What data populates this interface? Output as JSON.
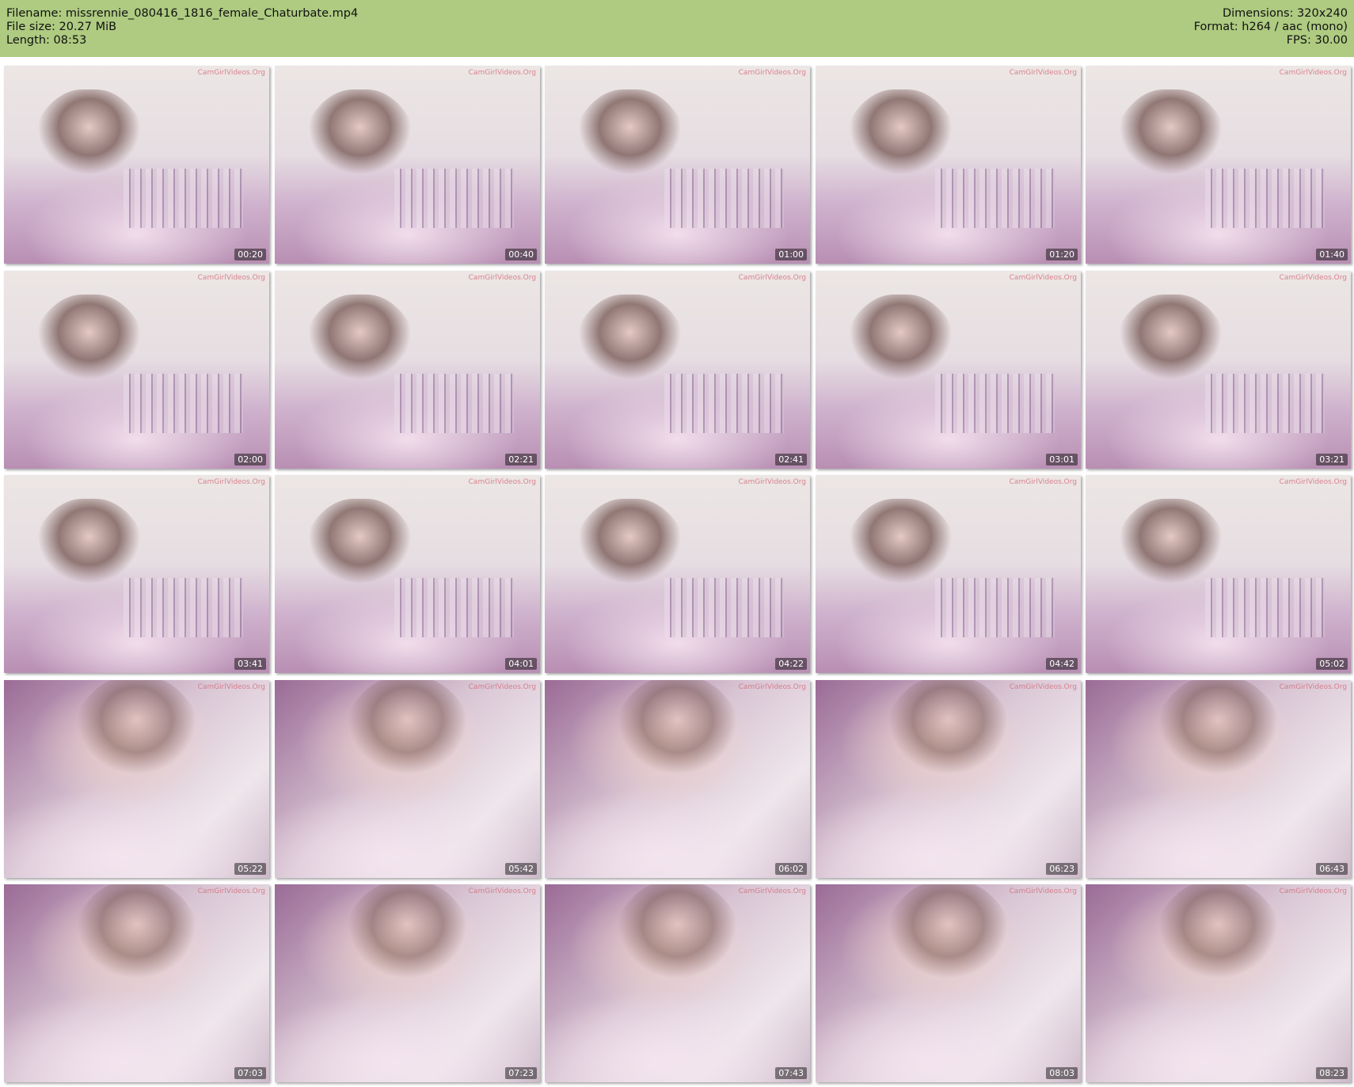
{
  "header": {
    "filename": "Filename: missrennie_080416_1816_female_Chaturbate.mp4",
    "filesize": "File size: 20.27 MiB",
    "length": "Length: 08:53",
    "dimensions": "Dimensions: 320x240",
    "format": "Format: h264 / aac (mono)",
    "fps": "FPS: 30.00"
  },
  "watermark": "CamGirlVideos.Org",
  "thumbnails": [
    {
      "time": "00:20",
      "shot": "wide"
    },
    {
      "time": "00:40",
      "shot": "wide"
    },
    {
      "time": "01:00",
      "shot": "wide"
    },
    {
      "time": "01:20",
      "shot": "wide"
    },
    {
      "time": "01:40",
      "shot": "wide"
    },
    {
      "time": "02:00",
      "shot": "wide"
    },
    {
      "time": "02:21",
      "shot": "wide"
    },
    {
      "time": "02:41",
      "shot": "wide"
    },
    {
      "time": "03:01",
      "shot": "wide"
    },
    {
      "time": "03:21",
      "shot": "wide"
    },
    {
      "time": "03:41",
      "shot": "wide"
    },
    {
      "time": "04:01",
      "shot": "wide"
    },
    {
      "time": "04:22",
      "shot": "wide"
    },
    {
      "time": "04:42",
      "shot": "wide"
    },
    {
      "time": "05:02",
      "shot": "wide"
    },
    {
      "time": "05:22",
      "shot": "close"
    },
    {
      "time": "05:42",
      "shot": "close"
    },
    {
      "time": "06:02",
      "shot": "close"
    },
    {
      "time": "06:23",
      "shot": "close"
    },
    {
      "time": "06:43",
      "shot": "close"
    },
    {
      "time": "07:03",
      "shot": "close"
    },
    {
      "time": "07:23",
      "shot": "close"
    },
    {
      "time": "07:43",
      "shot": "close"
    },
    {
      "time": "08:03",
      "shot": "close"
    },
    {
      "time": "08:23",
      "shot": "close"
    }
  ]
}
